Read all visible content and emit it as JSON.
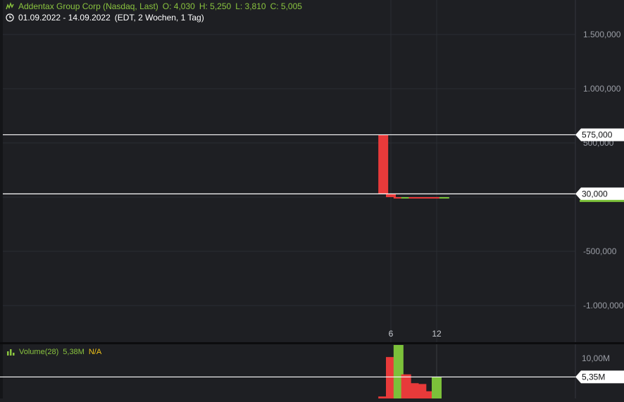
{
  "header": {
    "title": "Addentax Group Corp (Nasdaq, Last)",
    "open": "O: 4,030",
    "high": "H: 5,250",
    "low": "L: 3,810",
    "close": "C: 5,005",
    "range": "01.09.2022 - 14.09.2022",
    "interval": "(EDT, 2 Wochen, 1 Tag)"
  },
  "volume_header": {
    "label": "Volume(28)",
    "value": "5,38M",
    "na": "N/A"
  },
  "colors": {
    "up": "#7cc13a",
    "down": "#e83a3a",
    "background": "#1e1f23",
    "axis_text": "#9b9ea6",
    "grid": "#2b2d33"
  },
  "chart_data": [
    {
      "type": "bar",
      "title": "",
      "xlabel": "",
      "ylabel": "",
      "ylim": [
        -1500000,
        1800000
      ],
      "xlim": [
        1,
        15
      ],
      "y_ticks": [
        1500000,
        1000000,
        500000,
        0,
        -500000,
        -1000000
      ],
      "y_tick_labels": [
        "1.500,000",
        "1.000,000",
        "500,000",
        "0",
        "-500,000",
        "-1.000,000"
      ],
      "x_ticks": [
        6,
        12
      ],
      "x_tick_labels": [
        "6",
        "12"
      ],
      "grid": true,
      "markers": [
        {
          "label": "575,000",
          "value": 575000
        },
        {
          "label": "30,000",
          "value": 30000
        }
      ],
      "bars": [
        {
          "x": 5,
          "open": 575000,
          "close": 30000,
          "direction": "down"
        },
        {
          "x": 6,
          "open": 30000,
          "close": 10,
          "direction": "down"
        },
        {
          "x": 7,
          "open": 10,
          "close": 8,
          "direction": "down"
        },
        {
          "x": 8,
          "open": 8,
          "close": 9,
          "direction": "up"
        },
        {
          "x": 9,
          "open": 9,
          "close": 7,
          "direction": "down"
        },
        {
          "x": 10,
          "open": 7,
          "close": 6,
          "direction": "down"
        },
        {
          "x": 11,
          "open": 6,
          "close": 5,
          "direction": "down"
        },
        {
          "x": 12,
          "open": 5,
          "close": 4.5,
          "direction": "down"
        },
        {
          "x": 13,
          "open": 4.03,
          "close": 5.005,
          "direction": "up"
        }
      ]
    },
    {
      "type": "bar",
      "title": "",
      "xlabel": "",
      "ylabel": "",
      "ylim": [
        0,
        14000000
      ],
      "y_ticks": [
        10000000
      ],
      "y_tick_labels": [
        "10,00M"
      ],
      "markers": [
        {
          "label": "5,35M",
          "value": 5350000
        }
      ],
      "series": [
        {
          "name": "Volume(28)",
          "values": [
            {
              "x": 5,
              "value": 500000,
              "direction": "down"
            },
            {
              "x": 6,
              "value": 10300000,
              "direction": "down"
            },
            {
              "x": 7,
              "value": 13300000,
              "direction": "up"
            },
            {
              "x": 8,
              "value": 6000000,
              "direction": "down"
            },
            {
              "x": 9,
              "value": 3800000,
              "direction": "down"
            },
            {
              "x": 10,
              "value": 3600000,
              "direction": "down"
            },
            {
              "x": 11,
              "value": 1800000,
              "direction": "down"
            },
            {
              "x": 12,
              "value": 5380000,
              "direction": "up"
            }
          ]
        }
      ]
    }
  ]
}
